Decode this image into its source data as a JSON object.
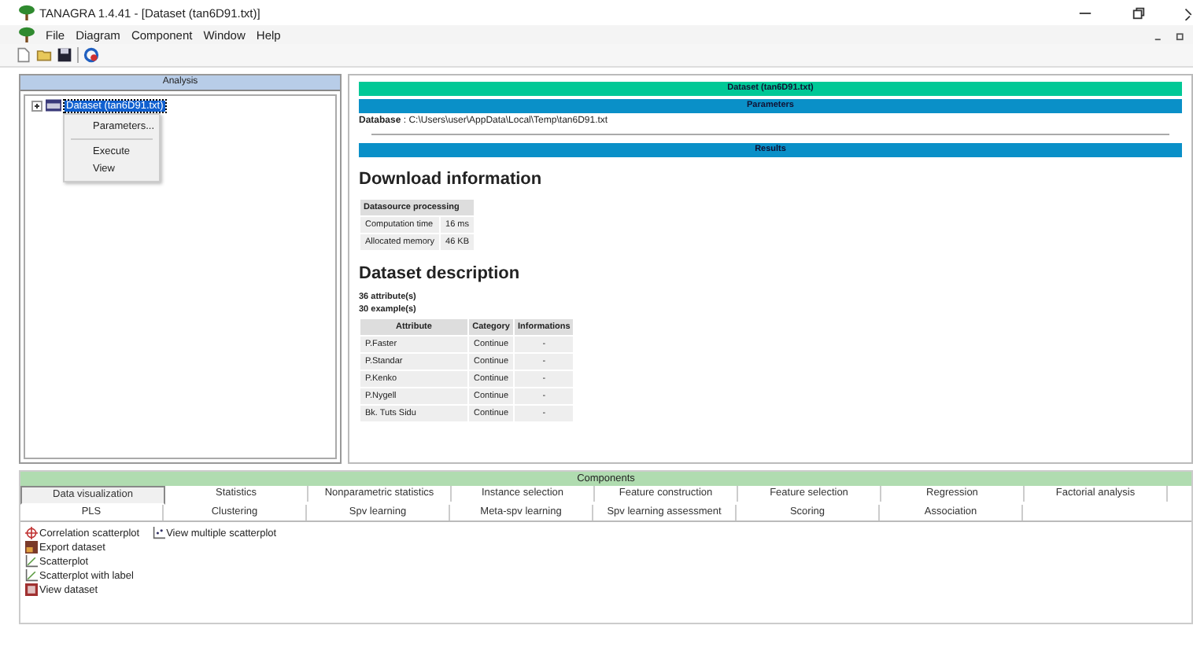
{
  "window": {
    "title": "TANAGRA 1.4.41 - [Dataset (tan6D91.txt)]"
  },
  "menu": [
    "File",
    "Diagram",
    "Component",
    "Window",
    "Help"
  ],
  "analysis": {
    "header": "Analysis",
    "tree": [
      {
        "label": "Dataset (tan6D91.txt)",
        "selected": true,
        "expanded": false
      }
    ],
    "context_menu": [
      {
        "label": "Parameters...",
        "separator_after": true
      },
      {
        "label": "Execute",
        "separator_after": false
      },
      {
        "label": "View",
        "separator_after": false
      }
    ]
  },
  "report": {
    "title_bar": "Dataset (tan6D91.txt)",
    "parameters_bar": "Parameters",
    "database_label": "Database",
    "database_path": " : C:\\Users\\user\\AppData\\Local\\Temp\\tan6D91.txt",
    "results_bar": "Results",
    "download_heading": "Download information",
    "download_table": {
      "header": "Datasource processing",
      "rows": [
        [
          "Computation time",
          "16 ms"
        ],
        [
          "Allocated memory",
          "46 KB"
        ]
      ]
    },
    "description_heading": "Dataset description",
    "counts": [
      "36 attribute(s)",
      "30 example(s)"
    ],
    "attributes": {
      "columns": [
        "Attribute",
        "Category",
        "Informations"
      ],
      "rows": [
        [
          "P.Faster",
          "Continue",
          "-"
        ],
        [
          "P.Standar",
          "Continue",
          "-"
        ],
        [
          "P.Kenko",
          "Continue",
          "-"
        ],
        [
          "P.Nygell",
          "Continue",
          "-"
        ],
        [
          "Bk. Tuts Sidu",
          "Continue",
          "-"
        ]
      ]
    }
  },
  "components": {
    "header": "Components",
    "tab_rows": [
      [
        {
          "label": "Data visualization",
          "selected": true
        },
        {
          "label": "Statistics",
          "selected": false
        },
        {
          "label": "Nonparametric statistics",
          "selected": false
        },
        {
          "label": "Instance selection",
          "selected": false
        },
        {
          "label": "Feature construction",
          "selected": false
        },
        {
          "label": "Feature selection",
          "selected": false
        },
        {
          "label": "Regression",
          "selected": false
        },
        {
          "label": "Factorial analysis",
          "selected": false
        }
      ],
      [
        {
          "label": "PLS",
          "selected": false
        },
        {
          "label": "Clustering",
          "selected": false
        },
        {
          "label": "Spv learning",
          "selected": false
        },
        {
          "label": "Meta-spv learning",
          "selected": false
        },
        {
          "label": "Spv learning assessment",
          "selected": false
        },
        {
          "label": "Scoring",
          "selected": false
        },
        {
          "label": "Association",
          "selected": false
        }
      ]
    ],
    "items": [
      [
        {
          "label": "Correlation scatterplot",
          "kind": "target"
        },
        {
          "label": "Export dataset",
          "kind": "export"
        },
        {
          "label": "Scatterplot",
          "kind": "plot"
        },
        {
          "label": "Scatterplot with label",
          "kind": "plot"
        },
        {
          "label": "View dataset",
          "kind": "view"
        }
      ],
      [
        {
          "label": "View multiple scatterplot",
          "kind": "multi"
        }
      ]
    ]
  }
}
